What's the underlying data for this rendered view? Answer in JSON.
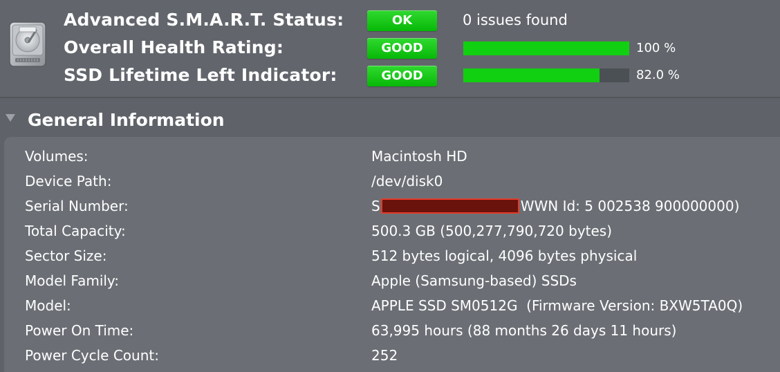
{
  "status": {
    "smart": {
      "label": "Advanced S.M.A.R.T. Status:",
      "badge": "OK",
      "text": "0 issues found"
    },
    "health": {
      "label": "Overall Health Rating:",
      "badge": "GOOD",
      "progress": 1.0,
      "percent_text": "100 %"
    },
    "lifetime": {
      "label": "SSD Lifetime Left Indicator:",
      "badge": "GOOD",
      "progress": 0.82,
      "percent_text": "82.0 %"
    },
    "badge_color": "#11c611",
    "bar_color": "#11cf11"
  },
  "icons": {
    "disk": "hard-drive-icon",
    "disclosure": "disclosure-triangle-icon"
  },
  "general": {
    "title": "General Information",
    "rows": [
      {
        "key": "Volumes:",
        "value": "Macintosh HD"
      },
      {
        "key": "Device Path:",
        "value": "/dev/disk0"
      },
      {
        "key": "Serial Number:",
        "value_prefix": "S",
        "value_suffix": "WWN Id: 5 002538 900000000)"
      },
      {
        "key": "Total Capacity:",
        "value": "500.3 GB (500,277,790,720 bytes)"
      },
      {
        "key": "Sector Size:",
        "value": "512 bytes logical, 4096 bytes physical"
      },
      {
        "key": "Model Family:",
        "value": "Apple (Samsung-based) SSDs"
      },
      {
        "key": "Model:",
        "value": "APPLE SSD SM0512G  (Firmware Version: BXW5TA0Q)"
      },
      {
        "key": "Power On Time:",
        "value": "63,995 hours (88 months 26 days 11 hours)"
      },
      {
        "key": "Power Cycle Count:",
        "value": "252"
      }
    ]
  }
}
